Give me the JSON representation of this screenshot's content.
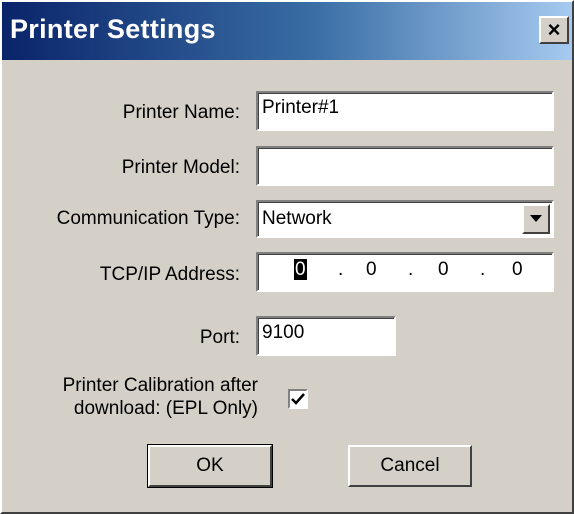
{
  "window": {
    "title": "Printer Settings",
    "close_glyph": "×",
    "colors": {
      "titlebar_start": "#0a246a",
      "titlebar_end": "#a6caf0",
      "dialog_bg": "#d4d0c8"
    }
  },
  "form": {
    "printer_name": {
      "label": "Printer Name:",
      "value": "Printer#1"
    },
    "printer_model": {
      "label": "Printer Model:",
      "value": ""
    },
    "communication_type": {
      "label": "Communication Type:",
      "value": "Network",
      "icon": "chevron-down-icon"
    },
    "tcp_ip": {
      "label": "TCP/IP Address:",
      "octets": [
        "0",
        "0",
        "0",
        "0"
      ],
      "separator": "."
    },
    "port": {
      "label": "Port:",
      "value": "9100"
    },
    "calibration": {
      "label_line1": "Printer Calibration after",
      "label_line2": "download: (EPL Only)",
      "checked": true,
      "icon": "checkmark-icon"
    }
  },
  "buttons": {
    "ok": "OK",
    "cancel": "Cancel"
  }
}
